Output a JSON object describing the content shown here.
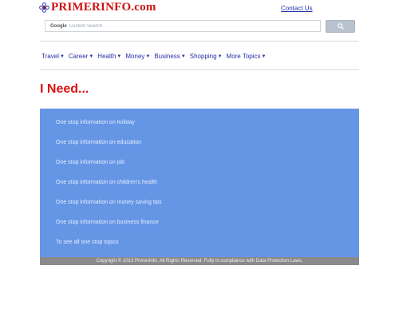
{
  "header": {
    "logo_text": "PRIMERINFO.com",
    "contact_label": "Contact Us"
  },
  "search": {
    "brand": "Google",
    "placeholder": "Custom Search",
    "button_icon": "search-icon"
  },
  "nav": {
    "items": [
      {
        "label": "Travel"
      },
      {
        "label": "Career"
      },
      {
        "label": "Health"
      },
      {
        "label": "Money"
      },
      {
        "label": "Business"
      },
      {
        "label": "Shopping"
      },
      {
        "label": "More Topics"
      }
    ],
    "dropdown_icon": "caret-down-icon"
  },
  "main": {
    "heading": "I Need...",
    "links": [
      "One stop information on holiday",
      "One stop information on education",
      "One stop information on job",
      "One stop information on children's health",
      "One stop information on money saving tips",
      "One stop information on business finance",
      "To see all one stop topics"
    ]
  },
  "footer": {
    "text": "Copyright © 2013 PrimerInfo. All Rights Reserved. Fully in compliance with Data Protection Laws."
  },
  "colors": {
    "logo_red": "#cc1111",
    "heading_red": "#dd1111",
    "nav_blue": "#2a2fa8",
    "panel_blue": "#6596e6",
    "footer_gray": "#8a8a8a"
  }
}
